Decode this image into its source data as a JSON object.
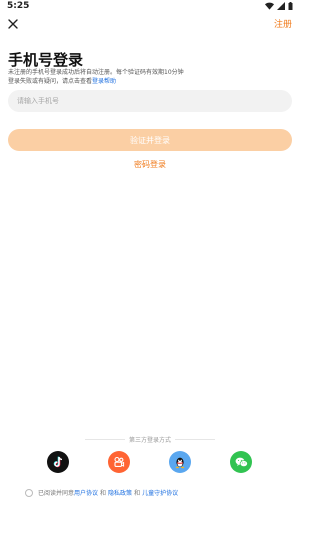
{
  "status_bar": {
    "time": "5:25"
  },
  "header": {
    "register_label": "注册"
  },
  "login": {
    "title": "手机号登录",
    "desc_line1": "未注册的手机号登录成功后将自动注册。每个验证码有效期10分钟",
    "desc_line2_prefix": "登录失败或有疑问，请点击查看",
    "help_link": "登录帮助",
    "phone_placeholder": "请输入手机号",
    "submit_label": "验证并登录",
    "password_login_label": "密码登录"
  },
  "third_party": {
    "title": "第三方登录方式",
    "providers": [
      "tiktok-icon",
      "kuaishou-icon",
      "qq-icon",
      "wechat-icon"
    ]
  },
  "agreement": {
    "prefix": "已阅读并同意",
    "user_agreement": "用户协议",
    "and1": "和",
    "privacy_policy": "隐私政策",
    "and2": "和",
    "child_protection": "儿童守护协议"
  },
  "colors": {
    "accent": "#f07a1a",
    "button_disabled": "#fbcfa4",
    "link": "#1d6fe0"
  }
}
